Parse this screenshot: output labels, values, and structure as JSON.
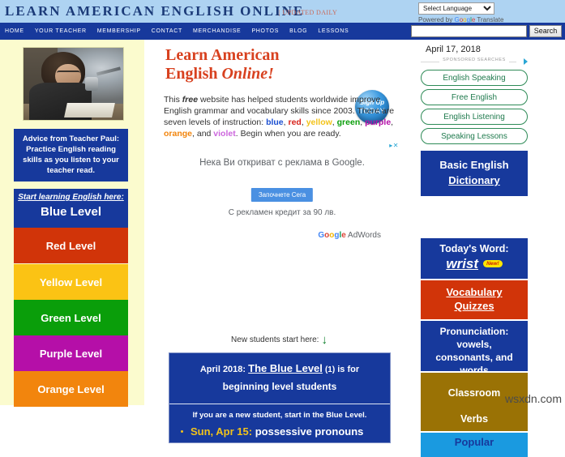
{
  "banner": {
    "site_title": "LEARN AMERICAN ENGLISH ONLINE",
    "updated_daily": "| UPDATED DAILY",
    "translate": {
      "selected_option": "Select Language",
      "options": [
        "Select Language"
      ],
      "credit_prefix": "Powered by ",
      "brand": "Google",
      "credit_suffix": " Translate"
    }
  },
  "nav": {
    "items": [
      {
        "label": "HOME",
        "name": "nav-home"
      },
      {
        "label": "YOUR TEACHER",
        "name": "nav-your-teacher"
      },
      {
        "label": "MEMBERSHIP",
        "name": "nav-membership"
      },
      {
        "label": "CONTACT",
        "name": "nav-contact"
      },
      {
        "label": "MERCHANDISE",
        "name": "nav-merchandise"
      },
      {
        "label": "PHOTOS",
        "name": "nav-photos"
      },
      {
        "label": "BLOG",
        "name": "nav-blog"
      },
      {
        "label": "LESSONS",
        "name": "nav-lessons"
      }
    ],
    "search": {
      "value": "",
      "placeholder": "",
      "button_label": "Search"
    }
  },
  "sidebar": {
    "advice": "Advice from Teacher Paul: Practice English reading skills as you listen to your teacher read.",
    "blue_level": {
      "start_text": "Start learning English here",
      "start_colon": ":",
      "level_label": "Blue Level"
    },
    "levels": [
      {
        "label": "Red Level",
        "color": "#d13409",
        "name": "level-red"
      },
      {
        "label": "Yellow Level",
        "color": "#fbc314",
        "name": "level-yellow"
      },
      {
        "label": "Green Level",
        "color": "#0a9e0a",
        "name": "level-green"
      },
      {
        "label": "Purple Level",
        "color": "#b50fa8",
        "name": "level-purple"
      },
      {
        "label": "Orange Level",
        "color": "#f2850d",
        "name": "level-orange"
      }
    ]
  },
  "main": {
    "heading_line1": "Learn American",
    "heading_line2_plain": "English ",
    "heading_line2_italic": "Online!",
    "signup_badge": {
      "line1": "Sign Up",
      "line2": "TODAY"
    },
    "intro": {
      "s1": "This ",
      "free": "free",
      "s2": " website has helped students worldwide improve English grammar and vocabulary skills since 2003. There are seven levels of instruction: ",
      "blue": "blue",
      "red": "red",
      "yellow": "yellow",
      "green": "green",
      "purple": "purple",
      "orange": "orange",
      "violet": "violet",
      "s3": ". Begin when you are ready.",
      "and": ", and "
    },
    "ad": {
      "ad_choices": "AdChoices",
      "headline": "Нека Ви откриват с реклама в Google.",
      "cta_label": "Започнете Сега",
      "subtext": "С рекламен кредит за 90 лв.",
      "brand_google": "Google",
      "brand_product": " AdWords"
    },
    "new_students_label": "New students start here:",
    "new_students_arrow": "↓",
    "announcement": {
      "date_prefix": "April 2018:",
      "level_link": "The Blue Level",
      "paren": "(1)",
      "is_for": "is for",
      "line2": "beginning level students",
      "body": "If you are a new student, start in the Blue Level.",
      "bullet_date": "Sun, Apr 15:",
      "bullet_topic": "possessive pronouns"
    }
  },
  "right": {
    "date": "April 17, 2018",
    "sponsored_label": "SPONSORED SEARCHES",
    "pills": [
      {
        "label": "English Speaking",
        "name": "pill-english-speaking"
      },
      {
        "label": "Free English",
        "name": "pill-free-english"
      },
      {
        "label": "English Listening",
        "name": "pill-english-listening"
      },
      {
        "label": "Speaking Lessons",
        "name": "pill-speaking-lessons"
      }
    ],
    "dictionary": {
      "line1": "Basic English",
      "line2": "Dictionary"
    },
    "todays_word": {
      "label": "Today's Word:",
      "word": "wrist",
      "badge": "New!"
    },
    "vocab_quizzes": {
      "line1": "Vocabulary",
      "line2": "Quizzes"
    },
    "pronunciation": {
      "line1": "Pronunciation:",
      "line2": "vowels,",
      "line3": "consonants, and",
      "line4": "words"
    },
    "classroom_verbs": {
      "line1": "Classroom",
      "line2": "Verbs"
    },
    "popular": "Popular"
  },
  "watermark": "wsxdn.com",
  "colors": {
    "banner_bg": "#aed3f2",
    "nav_bg": "#17399c",
    "sidebar_bg": "#fbfbce",
    "brand_blue": "#17399c",
    "heading_red": "#d8411f"
  }
}
